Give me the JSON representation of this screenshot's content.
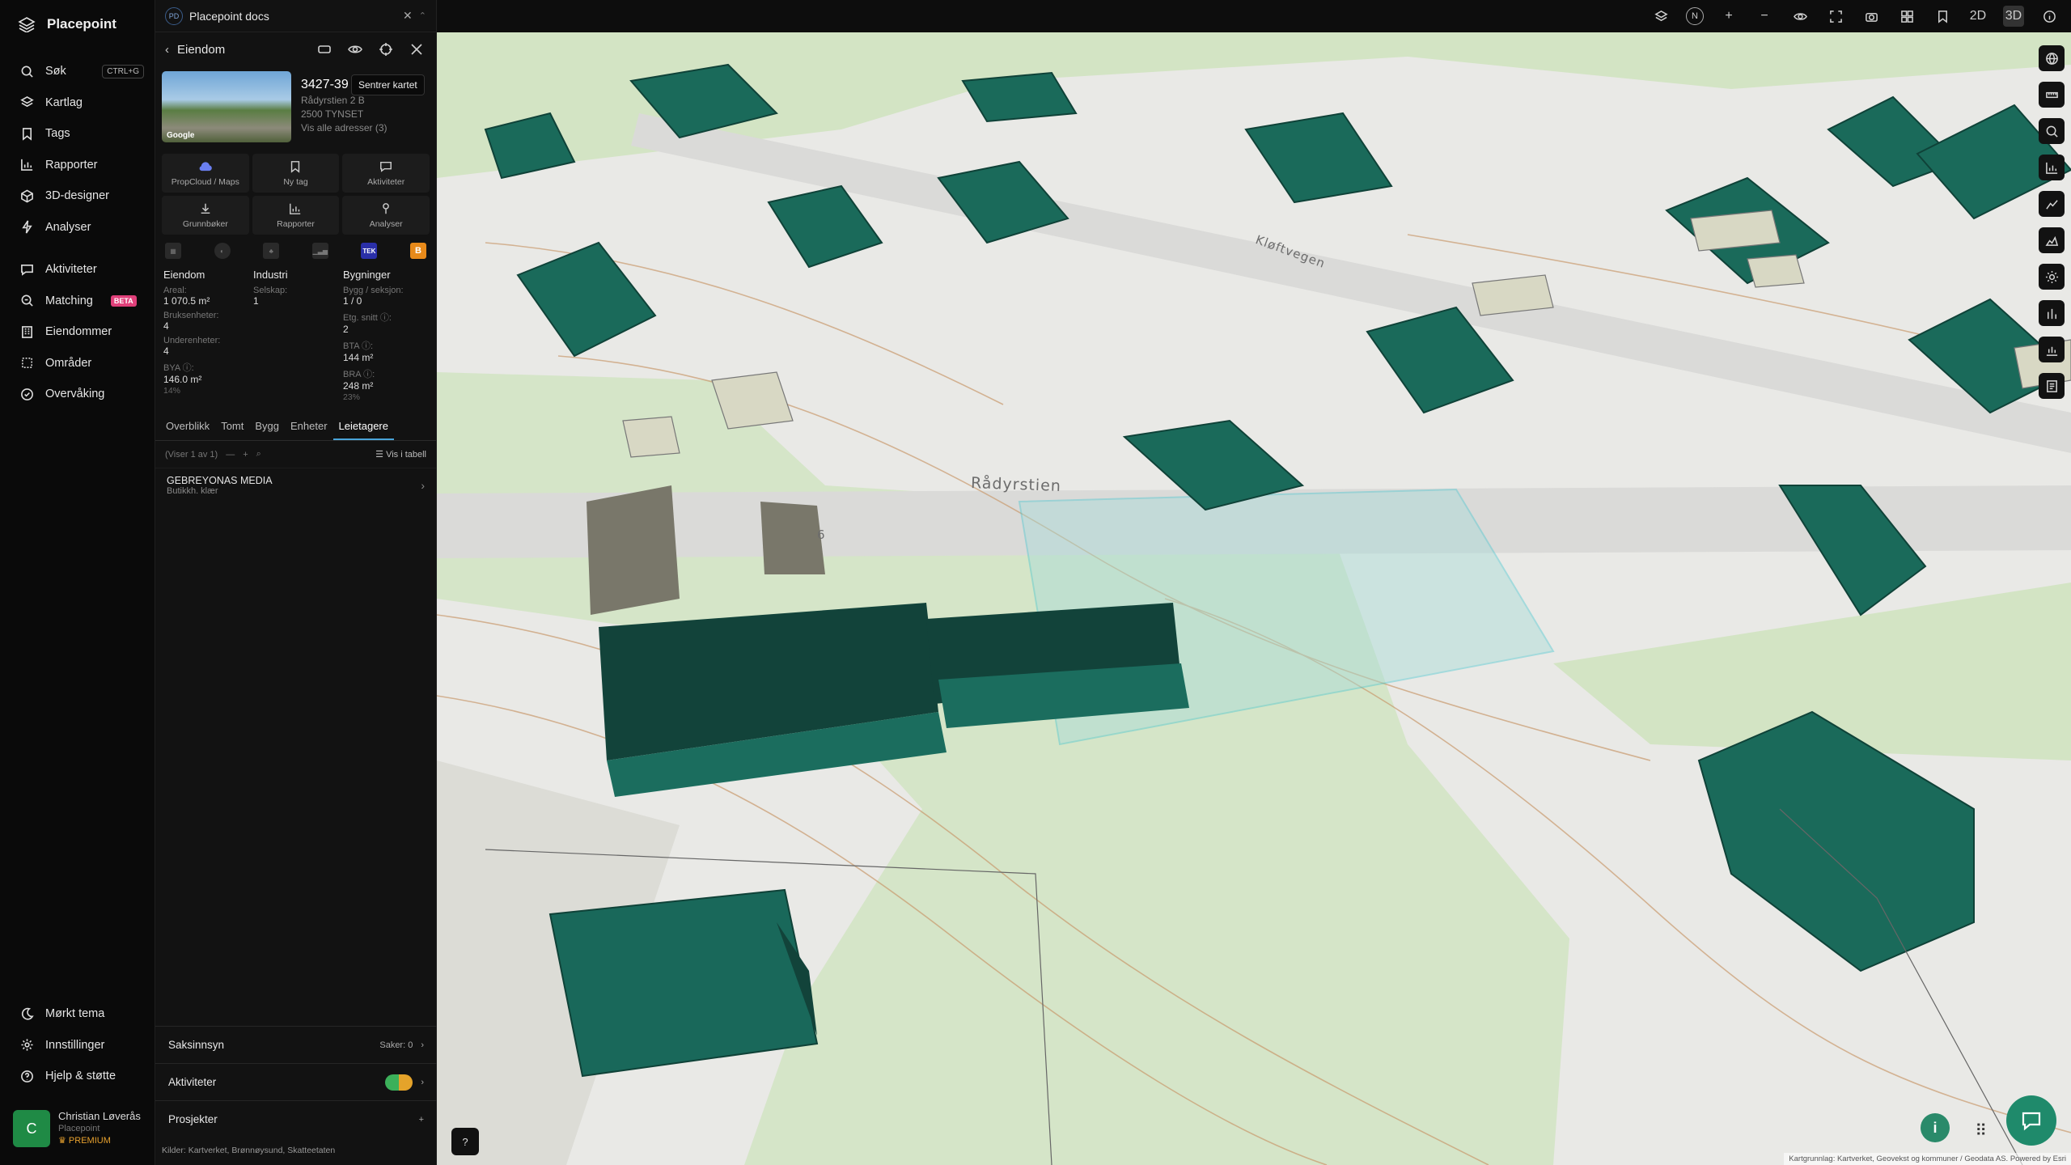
{
  "nav": {
    "brand": "Placepoint",
    "items": [
      {
        "label": "Søk",
        "icon": "search-icon",
        "kbd": "CTRL+G"
      },
      {
        "label": "Kartlag",
        "icon": "layers-icon"
      },
      {
        "label": "Tags",
        "icon": "bookmark-icon"
      },
      {
        "label": "Rapporter",
        "icon": "chart-icon"
      },
      {
        "label": "3D-designer",
        "icon": "cube-icon"
      },
      {
        "label": "Analyser",
        "icon": "bolt-icon"
      }
    ],
    "items2": [
      {
        "label": "Aktiviteter",
        "icon": "chat-icon"
      },
      {
        "label": "Matching",
        "icon": "match-icon",
        "badge": "BETA"
      },
      {
        "label": "Eiendommer",
        "icon": "building-icon"
      },
      {
        "label": "Områder",
        "icon": "area-icon"
      },
      {
        "label": "Overvåking",
        "icon": "watch-icon"
      }
    ],
    "bottom": [
      {
        "label": "Mørkt tema",
        "icon": "moon-icon"
      },
      {
        "label": "Innstillinger",
        "icon": "gear-icon"
      },
      {
        "label": "Hjelp & støtte",
        "icon": "help-icon"
      }
    ],
    "user": {
      "initial": "C",
      "name": "Christian Løverås",
      "company": "Placepoint",
      "plan": "PREMIUM"
    }
  },
  "panel": {
    "workspace_badge": "PD",
    "workspace": "Placepoint docs",
    "title": "Eiendom",
    "tooltip": "Sentrer kartet",
    "photo_label": "Google",
    "prop_id": "3427-39",
    "address": "Rådyrstien 2 B",
    "postal": "2500 TYNSET",
    "all_addresses": "Vis alle adresser (3)",
    "actions": [
      "PropCloud / Maps",
      "Ny tag",
      "Aktiviteter",
      "Grunnbøker",
      "Rapporter",
      "Analyser"
    ],
    "source_tek": "TEK",
    "columns": {
      "c1": {
        "title": "Eiendom",
        "rows": [
          {
            "k": "Areal:",
            "v": "1 070.5 m²"
          },
          {
            "k": "Bruksenheter:",
            "v": "4"
          },
          {
            "k": "Underenheter:",
            "v": "4"
          },
          {
            "k": "BYA ⓘ:",
            "v": "146.0 m²",
            "p": "14%"
          }
        ]
      },
      "c2": {
        "title": "Industri",
        "rows": [
          {
            "k": "Selskap:",
            "v": "1"
          }
        ]
      },
      "c3": {
        "title": "Bygninger",
        "rows": [
          {
            "k": "Bygg / seksjon:",
            "v": "1 / 0"
          },
          {
            "k": "Etg. snitt ⓘ:",
            "v": "2"
          },
          {
            "k": "BTA ⓘ:",
            "v": "144 m²"
          },
          {
            "k": "BRA ⓘ:",
            "v": "248 m²",
            "p": "23%"
          }
        ]
      }
    },
    "tabs": [
      "Overblikk",
      "Tomt",
      "Bygg",
      "Enheter",
      "Leietagere"
    ],
    "active_tab": "Leietagere",
    "list_count": "(Viser 1 av 1)",
    "table_view": "Vis i tabell",
    "tenant": {
      "name": "GEBREYONAS MEDIA",
      "sub": "Butikkh. klær"
    },
    "sections": [
      {
        "label": "Saksinnsyn",
        "right": "Saker: 0"
      },
      {
        "label": "Aktiviteter",
        "right": ""
      },
      {
        "label": "Prosjekter",
        "right": "+"
      }
    ],
    "sources_label": "Kilder:",
    "sources": [
      "Kartverket,",
      "Brønnøysund,",
      "Skatteetaten"
    ]
  },
  "topbar": {
    "mode_2d": "2D",
    "mode_3d": "3D",
    "active_mode": "3D",
    "compass": "N"
  },
  "map": {
    "street_label": "Rådyrstien",
    "street_label2": "Kløftvegen",
    "house_number": "6",
    "attribution": "Kartgrunnlag: Kartverket, Geovekst og kommuner / Geodata AS. Powered by Esri"
  }
}
